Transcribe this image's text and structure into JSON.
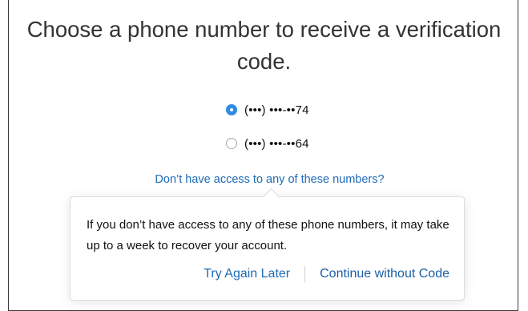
{
  "heading": {
    "line1": "Choose a phone number to receive a verification",
    "line2": "code."
  },
  "phone_options": [
    {
      "label": "(•••) •••-••74",
      "selected": true
    },
    {
      "label": "(•••) •••-••64",
      "selected": false
    }
  ],
  "access_link": "Don’t have access to any of these numbers?",
  "popover": {
    "message": "If you don’t have access to any of these phone numbers, it may take up to a week to recover your account.",
    "try_again_label": "Try Again Later",
    "continue_label": "Continue without Code"
  },
  "colors": {
    "accent": "#2f8be6",
    "link": "#1d6bb8"
  }
}
